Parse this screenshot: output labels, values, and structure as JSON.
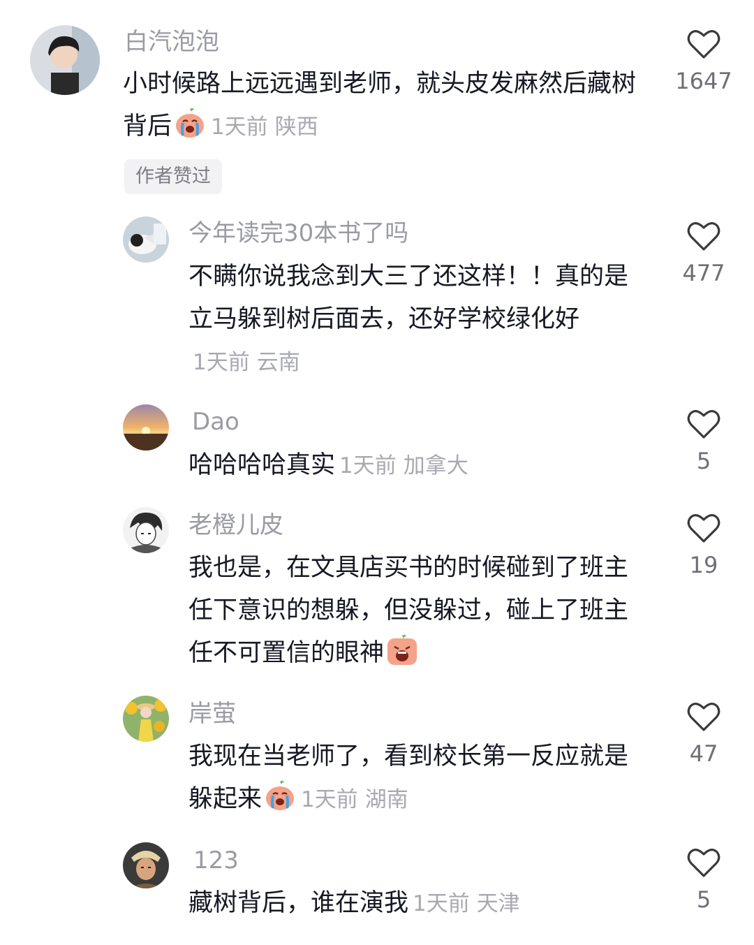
{
  "comments": [
    {
      "username": "白汽泡泡",
      "text": "小时候路上远远遇到老师，就头皮发麻然后藏树背后",
      "time": "1天前",
      "location": "陕西",
      "likes": "1647",
      "author_liked_tag": "作者赞过",
      "emoji": "crying-emoji"
    },
    {
      "username": "今年读完30本书了吗",
      "text": "不瞒你说我念到大三了还这样！！真的是立马躲到树后面去，还好学校绿化好",
      "time": "1天前",
      "location": "云南",
      "likes": "477"
    },
    {
      "username": "Dao",
      "text": "哈哈哈哈真实",
      "time": "1天前",
      "location": "加拿大",
      "likes": "5"
    },
    {
      "username": "老橙儿皮",
      "text": "我也是，在文具店买书的时候碰到了班主任下意识的想躲，但没躲过，碰上了班主任不可置信的眼神",
      "likes": "19",
      "emoji": "scream-emoji"
    },
    {
      "username": "岸萤",
      "text": "我现在当老师了，看到校长第一反应就是躲起来",
      "time": "1天前",
      "location": "湖南",
      "likes": "47",
      "emoji": "crying-emoji"
    },
    {
      "username": "123",
      "text": "藏树背后，谁在演我",
      "time": "1天前",
      "location": "天津",
      "likes": "5"
    }
  ],
  "colors": {
    "text": "#161823",
    "username": "#9a9ba3",
    "meta": "#a8a9b0",
    "heart": "#3a3a3a"
  }
}
